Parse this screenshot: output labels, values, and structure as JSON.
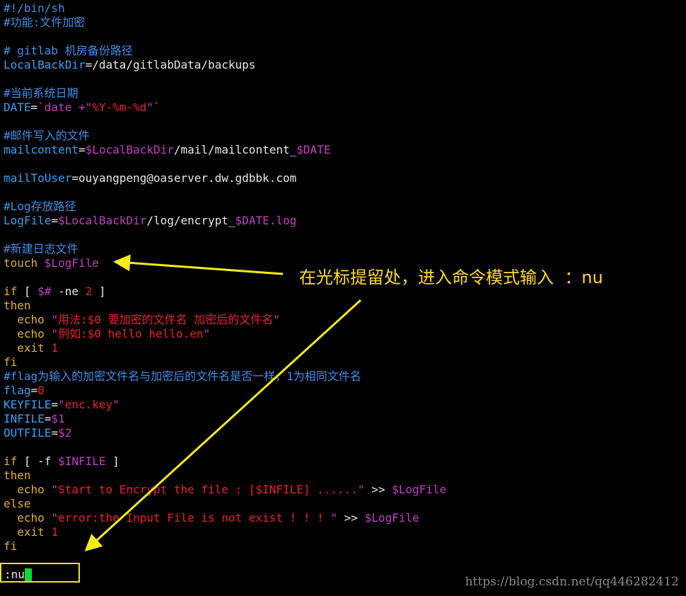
{
  "editor": {
    "lines": [
      [
        {
          "c": "cmt",
          "t": "#!/bin/sh"
        }
      ],
      [
        {
          "c": "cmt",
          "t": "#功能:文件加密"
        }
      ],
      [],
      [
        {
          "c": "cmt",
          "t": "# gitlab 机房备份路径"
        }
      ],
      [
        {
          "c": "var",
          "t": "LocalBackDir"
        },
        {
          "c": "plain",
          "t": "=/data/gitlabData/backups"
        }
      ],
      [],
      [
        {
          "c": "cmt",
          "t": "#当前系统日期"
        }
      ],
      [
        {
          "c": "var",
          "t": "DATE"
        },
        {
          "c": "plain",
          "t": "="
        },
        {
          "c": "sub",
          "t": "`date +\""
        },
        {
          "c": "str",
          "t": "%Y-%m-%d"
        },
        {
          "c": "sub",
          "t": "\"`"
        }
      ],
      [],
      [
        {
          "c": "cmt",
          "t": "#邮件写入的文件"
        }
      ],
      [
        {
          "c": "var",
          "t": "mailcontent"
        },
        {
          "c": "plain",
          "t": "="
        },
        {
          "c": "sub",
          "t": "$LocalBackDir"
        },
        {
          "c": "plain",
          "t": "/mail/mailcontent_"
        },
        {
          "c": "sub",
          "t": "$DATE"
        }
      ],
      [],
      [
        {
          "c": "var",
          "t": "mailToUser"
        },
        {
          "c": "plain",
          "t": "=ouyangpeng@oaserver.dw.gdbbk.com"
        }
      ],
      [],
      [
        {
          "c": "cmt",
          "t": "#Log存放路径"
        }
      ],
      [
        {
          "c": "var",
          "t": "LogFile"
        },
        {
          "c": "plain",
          "t": "="
        },
        {
          "c": "sub",
          "t": "$LocalBackDir"
        },
        {
          "c": "plain",
          "t": "/log/encrypt_"
        },
        {
          "c": "sub",
          "t": "$DATE.log"
        }
      ],
      [],
      [
        {
          "c": "cmt",
          "t": "#新建日志文件"
        }
      ],
      [
        {
          "c": "kw",
          "t": "touch "
        },
        {
          "c": "sub",
          "t": "$LogFile"
        }
      ],
      [],
      [
        {
          "c": "kw",
          "t": "if"
        },
        {
          "c": "plain",
          "t": " [ "
        },
        {
          "c": "sub",
          "t": "$#"
        },
        {
          "c": "plain",
          "t": " -ne "
        },
        {
          "c": "num",
          "t": "2"
        },
        {
          "c": "plain",
          "t": " ]"
        }
      ],
      [
        {
          "c": "kw",
          "t": "then"
        }
      ],
      [
        {
          "c": "kw",
          "t": "  echo "
        },
        {
          "c": "sub",
          "t": "\""
        },
        {
          "c": "str",
          "t": "用法:$0 要加密的文件名 加密后的文件名"
        },
        {
          "c": "sub",
          "t": "\""
        }
      ],
      [
        {
          "c": "kw",
          "t": "  echo "
        },
        {
          "c": "sub",
          "t": "\""
        },
        {
          "c": "str",
          "t": "例如:$0 hello hello.en"
        },
        {
          "c": "sub",
          "t": "\""
        }
      ],
      [
        {
          "c": "kw",
          "t": "  exit "
        },
        {
          "c": "num",
          "t": "1"
        }
      ],
      [
        {
          "c": "kw",
          "t": "fi"
        }
      ],
      [
        {
          "c": "cmt",
          "t": "#flag为输入的加密文件名与加密后的文件名是否一样，1为相同文件名"
        }
      ],
      [
        {
          "c": "var",
          "t": "flag"
        },
        {
          "c": "plain",
          "t": "="
        },
        {
          "c": "num",
          "t": "0"
        }
      ],
      [
        {
          "c": "var",
          "t": "KEYFILE"
        },
        {
          "c": "plain",
          "t": "="
        },
        {
          "c": "sub",
          "t": "\""
        },
        {
          "c": "str",
          "t": "enc.key"
        },
        {
          "c": "sub",
          "t": "\""
        }
      ],
      [
        {
          "c": "var",
          "t": "INFILE"
        },
        {
          "c": "plain",
          "t": "="
        },
        {
          "c": "sub",
          "t": "$1"
        }
      ],
      [
        {
          "c": "var",
          "t": "OUTFILE"
        },
        {
          "c": "plain",
          "t": "="
        },
        {
          "c": "sub",
          "t": "$2"
        }
      ],
      [],
      [
        {
          "c": "kw",
          "t": "if"
        },
        {
          "c": "plain",
          "t": " [ -f "
        },
        {
          "c": "sub",
          "t": "$INFILE"
        },
        {
          "c": "plain",
          "t": " ]"
        }
      ],
      [
        {
          "c": "kw",
          "t": "then"
        }
      ],
      [
        {
          "c": "kw",
          "t": "  echo "
        },
        {
          "c": "sub",
          "t": "\""
        },
        {
          "c": "str",
          "t": "Start to Encrypt the file : [$INFILE] ......"
        },
        {
          "c": "sub",
          "t": "\""
        },
        {
          "c": "plain",
          "t": " >> "
        },
        {
          "c": "sub",
          "t": "$LogFile"
        }
      ],
      [
        {
          "c": "kw",
          "t": "else"
        }
      ],
      [
        {
          "c": "kw",
          "t": "  echo "
        },
        {
          "c": "sub",
          "t": "\""
        },
        {
          "c": "str",
          "t": "error:the Input File is not exist ! ! ! "
        },
        {
          "c": "sub",
          "t": "\""
        },
        {
          "c": "plain",
          "t": " >> "
        },
        {
          "c": "sub",
          "t": "$LogFile"
        }
      ],
      [
        {
          "c": "kw",
          "t": "  exit "
        },
        {
          "c": "num",
          "t": "1"
        }
      ],
      [
        {
          "c": "kw",
          "t": "fi"
        }
      ]
    ]
  },
  "command_line": {
    "text": ":nu"
  },
  "annotation": {
    "text": "在光标提留处，进入命令模式输入  ：nu"
  },
  "watermark": "https://blog.csdn.net/qq446282412"
}
